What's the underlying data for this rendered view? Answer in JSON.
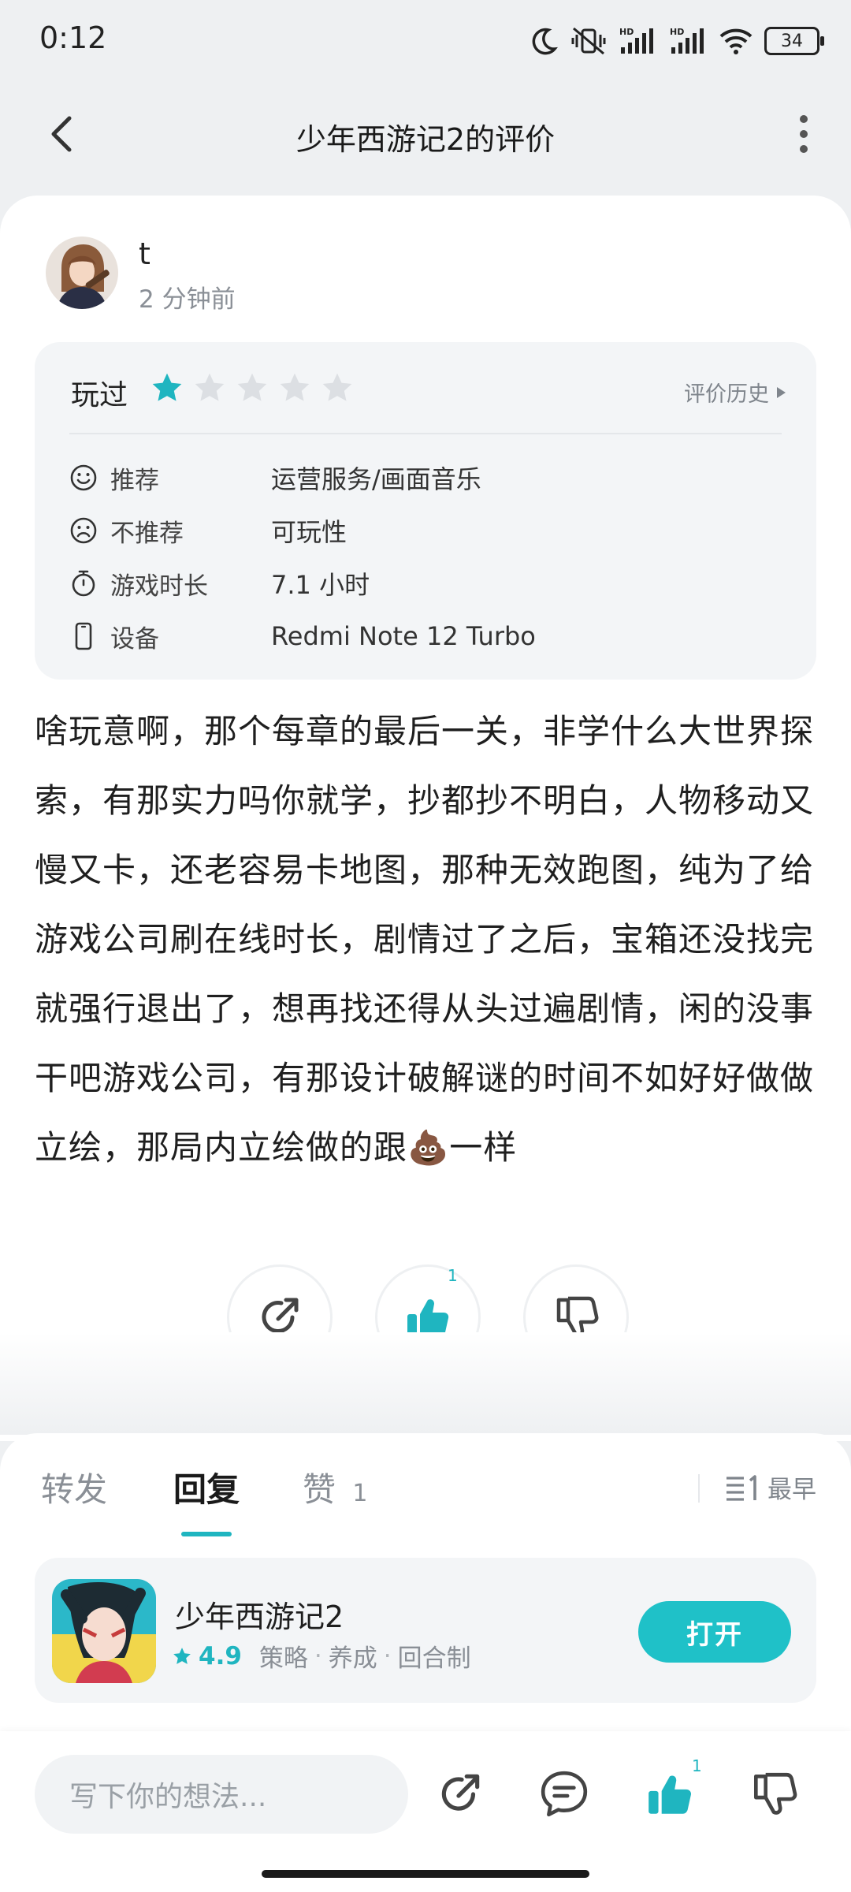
{
  "status_bar": {
    "time": "0:12",
    "battery": "34",
    "icons": [
      "moon-icon",
      "vibrate-off-icon",
      "signal-hd-icon",
      "signal-hd-icon",
      "wifi-icon",
      "battery-icon"
    ]
  },
  "header": {
    "title": "少年西游记2的评价",
    "back_icon": "chevron-left-icon",
    "more_icon": "more-vertical-icon"
  },
  "review": {
    "user_name": "t",
    "time_ago": "2 分钟前",
    "played_label": "玩过",
    "rating": 1,
    "rating_max": 5,
    "history_label": "评价历史",
    "details": [
      {
        "icon": "smile-icon",
        "label": "推荐",
        "value": "运营服务/画面音乐"
      },
      {
        "icon": "frown-icon",
        "label": "不推荐",
        "value": "可玩性"
      },
      {
        "icon": "stopwatch-icon",
        "label": "游戏时长",
        "value": "7.1 小时"
      },
      {
        "icon": "phone-icon",
        "label": "设备",
        "value": "Redmi Note 12 Turbo"
      }
    ],
    "text": "啥玩意啊，那个每章的最后一关，非学什么大世界探索，有那实力吗你就学，抄都抄不明白，人物移动又慢又卡，还老容易卡地图，那种无效跑图，纯为了给游戏公司刷在线时长，剧情过了之后，宝箱还没找完就强行退出了，想再找还得从头过遍剧情，闲的没事干吧游戏公司，有那设计破解谜的时间不如好好做做立绘，那局内立绘做的跟💩一样",
    "like_count": "1"
  },
  "tabs": [
    {
      "label": "转发",
      "active": false
    },
    {
      "label": "回复",
      "active": true
    },
    {
      "label": "赞",
      "count": "1",
      "active": false
    }
  ],
  "sort_label": "最早",
  "game": {
    "name": "少年西游记2",
    "score": "4.9",
    "tags": [
      "策略",
      "养成",
      "回合制"
    ],
    "open_label": "打开"
  },
  "bottom_bar": {
    "input_placeholder": "写下你的想法...",
    "like_count": "1"
  },
  "colors": {
    "accent": "#1fb5c0",
    "open_button": "#1fc1c8",
    "background": "#eef0f2"
  }
}
